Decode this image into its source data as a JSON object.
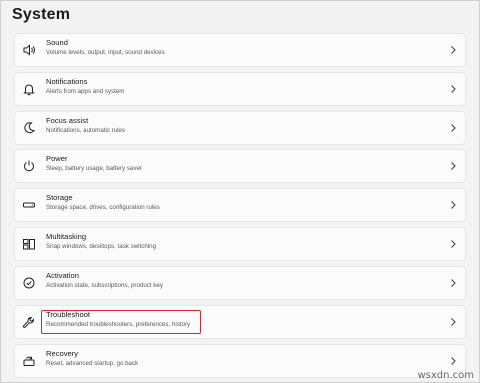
{
  "page": {
    "title": "System"
  },
  "items": [
    {
      "label": "Sound",
      "desc": "Volume levels, output, input, sound devices",
      "icon": "speaker-icon"
    },
    {
      "label": "Notifications",
      "desc": "Alerts from apps and system",
      "icon": "bell-icon"
    },
    {
      "label": "Focus assist",
      "desc": "Notifications, automatic rules",
      "icon": "moon-icon"
    },
    {
      "label": "Power",
      "desc": "Sleep, battery usage, battery saver",
      "icon": "power-icon"
    },
    {
      "label": "Storage",
      "desc": "Storage space, drives, configuration rules",
      "icon": "drive-icon"
    },
    {
      "label": "Multitasking",
      "desc": "Snap windows, desktops, task switching",
      "icon": "multitask-icon"
    },
    {
      "label": "Activation",
      "desc": "Activation state, subscriptions, product key",
      "icon": "check-circle-icon"
    },
    {
      "label": "Troubleshoot",
      "desc": "Recommended troubleshooters, preferences, history",
      "icon": "wrench-icon"
    },
    {
      "label": "Recovery",
      "desc": "Reset, advanced startup, go back",
      "icon": "recovery-icon"
    }
  ],
  "highlight": {
    "item": "Troubleshoot",
    "color": "#e0202a"
  },
  "watermark": "wsxdn.com"
}
